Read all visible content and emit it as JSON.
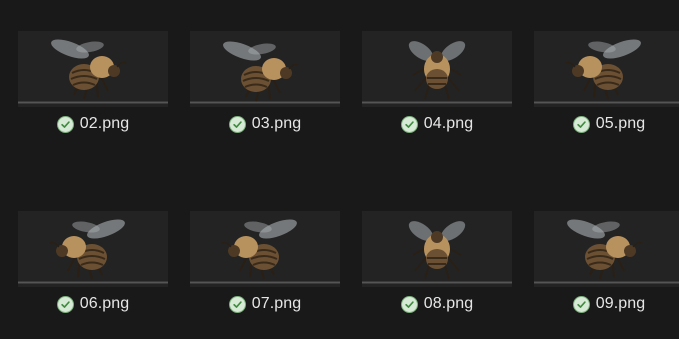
{
  "files": [
    {
      "name": "02.png",
      "pose": "side-left",
      "status": "synced"
    },
    {
      "name": "03.png",
      "pose": "side-left-tilt",
      "status": "synced"
    },
    {
      "name": "04.png",
      "pose": "back",
      "status": "synced"
    },
    {
      "name": "05.png",
      "pose": "back-right",
      "status": "synced"
    },
    {
      "name": "06.png",
      "pose": "side-right",
      "status": "synced"
    },
    {
      "name": "07.png",
      "pose": "three-quarter-right",
      "status": "synced"
    },
    {
      "name": "08.png",
      "pose": "front",
      "status": "synced"
    },
    {
      "name": "09.png",
      "pose": "three-quarter-left",
      "status": "synced"
    }
  ],
  "colors": {
    "background": "#191919",
    "thumbnail_bg": "#232323",
    "bee_body": "#6b5033",
    "bee_fur": "#b8925e",
    "bee_wing": "#aab0b4",
    "text": "#e6e6e6",
    "status_check": "#3f8a3f"
  },
  "icons": {
    "status": "check-circle-icon"
  }
}
